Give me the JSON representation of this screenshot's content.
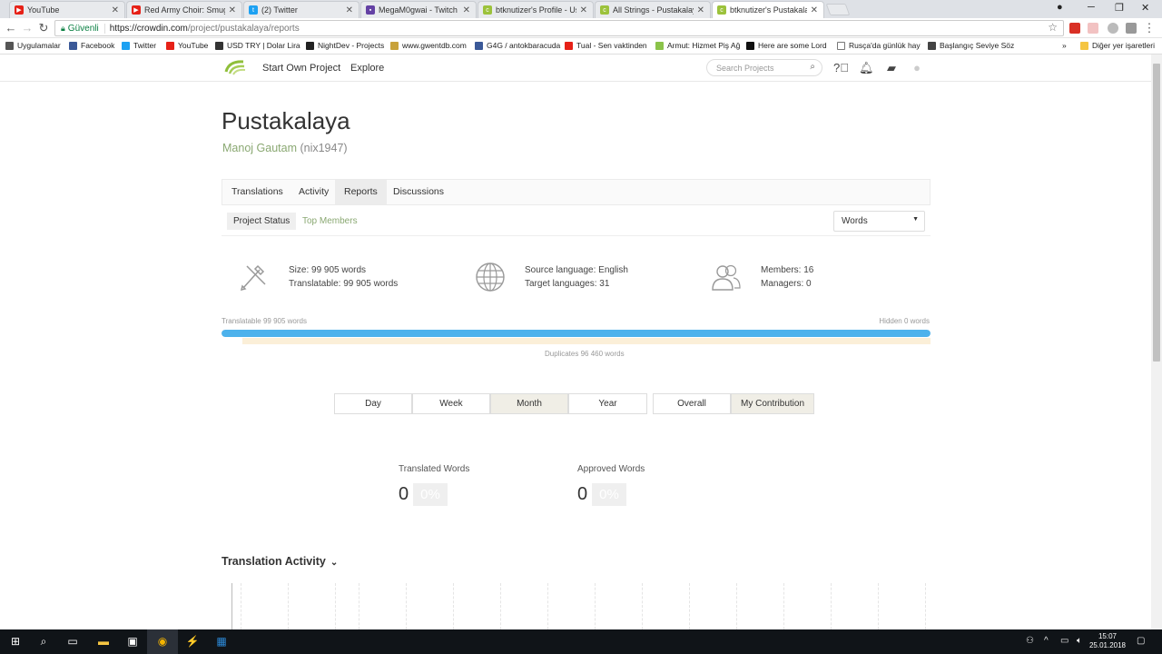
{
  "browser": {
    "tabs": [
      {
        "title": "YouTube",
        "color": "#e62117"
      },
      {
        "title": "Red Army Choir: Smuglia",
        "color": "#e62117"
      },
      {
        "title": "(2) Twitter",
        "color": "#1da1f2"
      },
      {
        "title": "MegaM0gwai - Twitch",
        "color": "#6441a4"
      },
      {
        "title": "btknutizer's Profile - User",
        "color": "#9cc23b"
      },
      {
        "title": "All Strings - Pustakalaya",
        "color": "#9cc23b"
      },
      {
        "title": "btknutizer's Pustakalaya",
        "color": "#9cc23b"
      }
    ],
    "secure_label": "Güvenli",
    "url_host": "https://crowdin.com",
    "url_path": "/project/pustakalaya/reports",
    "bookmarks": [
      "Uygulamalar",
      "Facebook",
      "Twitter",
      "YouTube",
      "USD TRY | Dolar Lira",
      "NightDev - Projects",
      "www.gwentdb.com",
      "G4G / antokbaracuda",
      "Tual - Sen vaktinden",
      "Armut: Hizmet Piş Ağ",
      "Here are some Lord",
      "Rusça'da günlük hay",
      "Başlangıç Seviye Söz",
      "Diğer yer işaretleri"
    ]
  },
  "header": {
    "start_own_project": "Start Own Project",
    "explore": "Explore",
    "search_placeholder": "Search Projects"
  },
  "project": {
    "title": "Pustakalaya",
    "owner_name": "Manoj Gautam",
    "owner_nick": "(nix1947)"
  },
  "tabs": [
    "Translations",
    "Activity",
    "Reports",
    "Discussions"
  ],
  "subtabs": {
    "project_status": "Project Status",
    "top_members": "Top Members"
  },
  "unit_select": "Words",
  "stats": {
    "size": "Size: 99 905 words",
    "translatable": "Translatable: 99 905 words",
    "source_language": "Source language: English",
    "target_languages": "Target languages: 31",
    "members": "Members: 16",
    "managers": "Managers: 0"
  },
  "bar": {
    "translatable_label": "Translatable 99 905 words",
    "hidden_label": "Hidden 0 words",
    "duplicates_label": "Duplicates 96 460 words",
    "translatable_fraction": 1.0,
    "fill_color": "#4db2ec"
  },
  "periods": [
    "Day",
    "Week",
    "Month",
    "Year"
  ],
  "scopes": [
    "Overall",
    "My Contribution"
  ],
  "metrics": {
    "translated_label": "Translated Words",
    "translated_value": "0",
    "translated_pct": "0%",
    "approved_label": "Approved Words",
    "approved_value": "0",
    "approved_pct": "0%"
  },
  "activity_title": "Translation Activity",
  "taskbar": {
    "time": "15:07",
    "date": "25.01.2018"
  }
}
